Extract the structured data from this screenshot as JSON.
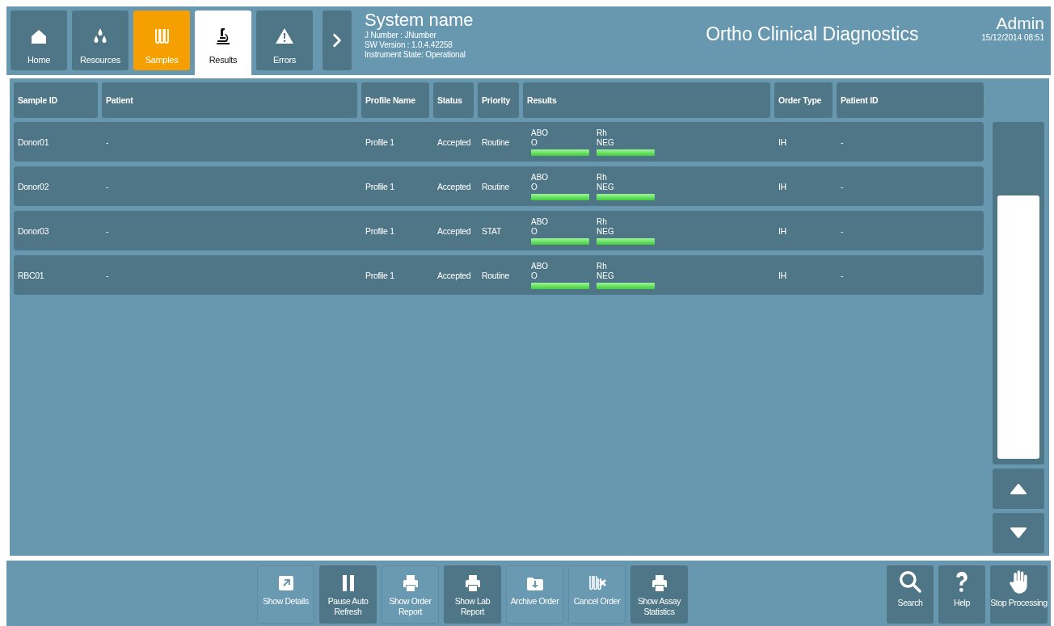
{
  "header": {
    "tabs": [
      {
        "label": "Home",
        "selected": false,
        "highlighted": false
      },
      {
        "label": "Resources",
        "selected": false,
        "highlighted": false
      },
      {
        "label": "Samples",
        "selected": false,
        "highlighted": true
      },
      {
        "label": "Results",
        "selected": true,
        "highlighted": false
      },
      {
        "label": "Errors",
        "selected": false,
        "highlighted": false
      }
    ],
    "system": {
      "name": "System name",
      "j_number": "J Number : JNumber",
      "sw_version": "SW Version : 1.0.4.42258",
      "instrument_state": "Instrument State: Operational"
    },
    "company": "Ortho Clinical Diagnostics",
    "user": "Admin",
    "datetime": "15/12/2014 08:51"
  },
  "table": {
    "columns": [
      "Sample ID",
      "Patient",
      "Profile Name",
      "Status",
      "Priority",
      "Results",
      "Order Type",
      "Patient ID"
    ],
    "rows": [
      {
        "sample_id": "Donor01",
        "patient": "-",
        "profile_name": "Profile 1",
        "status": "Accepted",
        "priority": "Routine",
        "results": [
          {
            "name": "ABO",
            "value": "O",
            "level": 1
          },
          {
            "name": "Rh",
            "value": "NEG",
            "level": 1
          }
        ],
        "order_type": "IH",
        "patient_id": "-"
      },
      {
        "sample_id": "Donor02",
        "patient": "-",
        "profile_name": "Profile 1",
        "status": "Accepted",
        "priority": "Routine",
        "results": [
          {
            "name": "ABO",
            "value": "O",
            "level": 1
          },
          {
            "name": "Rh",
            "value": "NEG",
            "level": 1
          }
        ],
        "order_type": "IH",
        "patient_id": "-"
      },
      {
        "sample_id": "Donor03",
        "patient": "-",
        "profile_name": "Profile 1",
        "status": "Accepted",
        "priority": "STAT",
        "results": [
          {
            "name": "ABO",
            "value": "O",
            "level": 1
          },
          {
            "name": "Rh",
            "value": "NEG",
            "level": 1
          }
        ],
        "order_type": "IH",
        "patient_id": "-"
      },
      {
        "sample_id": "RBC01",
        "patient": "-",
        "profile_name": "Profile 1",
        "status": "Accepted",
        "priority": "Routine",
        "results": [
          {
            "name": "ABO",
            "value": "O",
            "level": 1
          },
          {
            "name": "Rh",
            "value": "NEG",
            "level": 1
          }
        ],
        "order_type": "IH",
        "patient_id": "-"
      }
    ]
  },
  "toolbar": {
    "actions": [
      {
        "label": "Show Details",
        "disabled": true
      },
      {
        "label": "Pause Auto Refresh",
        "disabled": false
      },
      {
        "label": "Show Order Report",
        "disabled": true
      },
      {
        "label": "Show Lab Report",
        "disabled": false
      },
      {
        "label": "Archive Order",
        "disabled": true
      },
      {
        "label": "Cancel Order",
        "disabled": true
      },
      {
        "label": "Show Assay Statistics",
        "disabled": false
      }
    ],
    "system_actions": [
      {
        "label": "Search"
      },
      {
        "label": "Help"
      },
      {
        "label": "Stop Processing"
      }
    ]
  }
}
